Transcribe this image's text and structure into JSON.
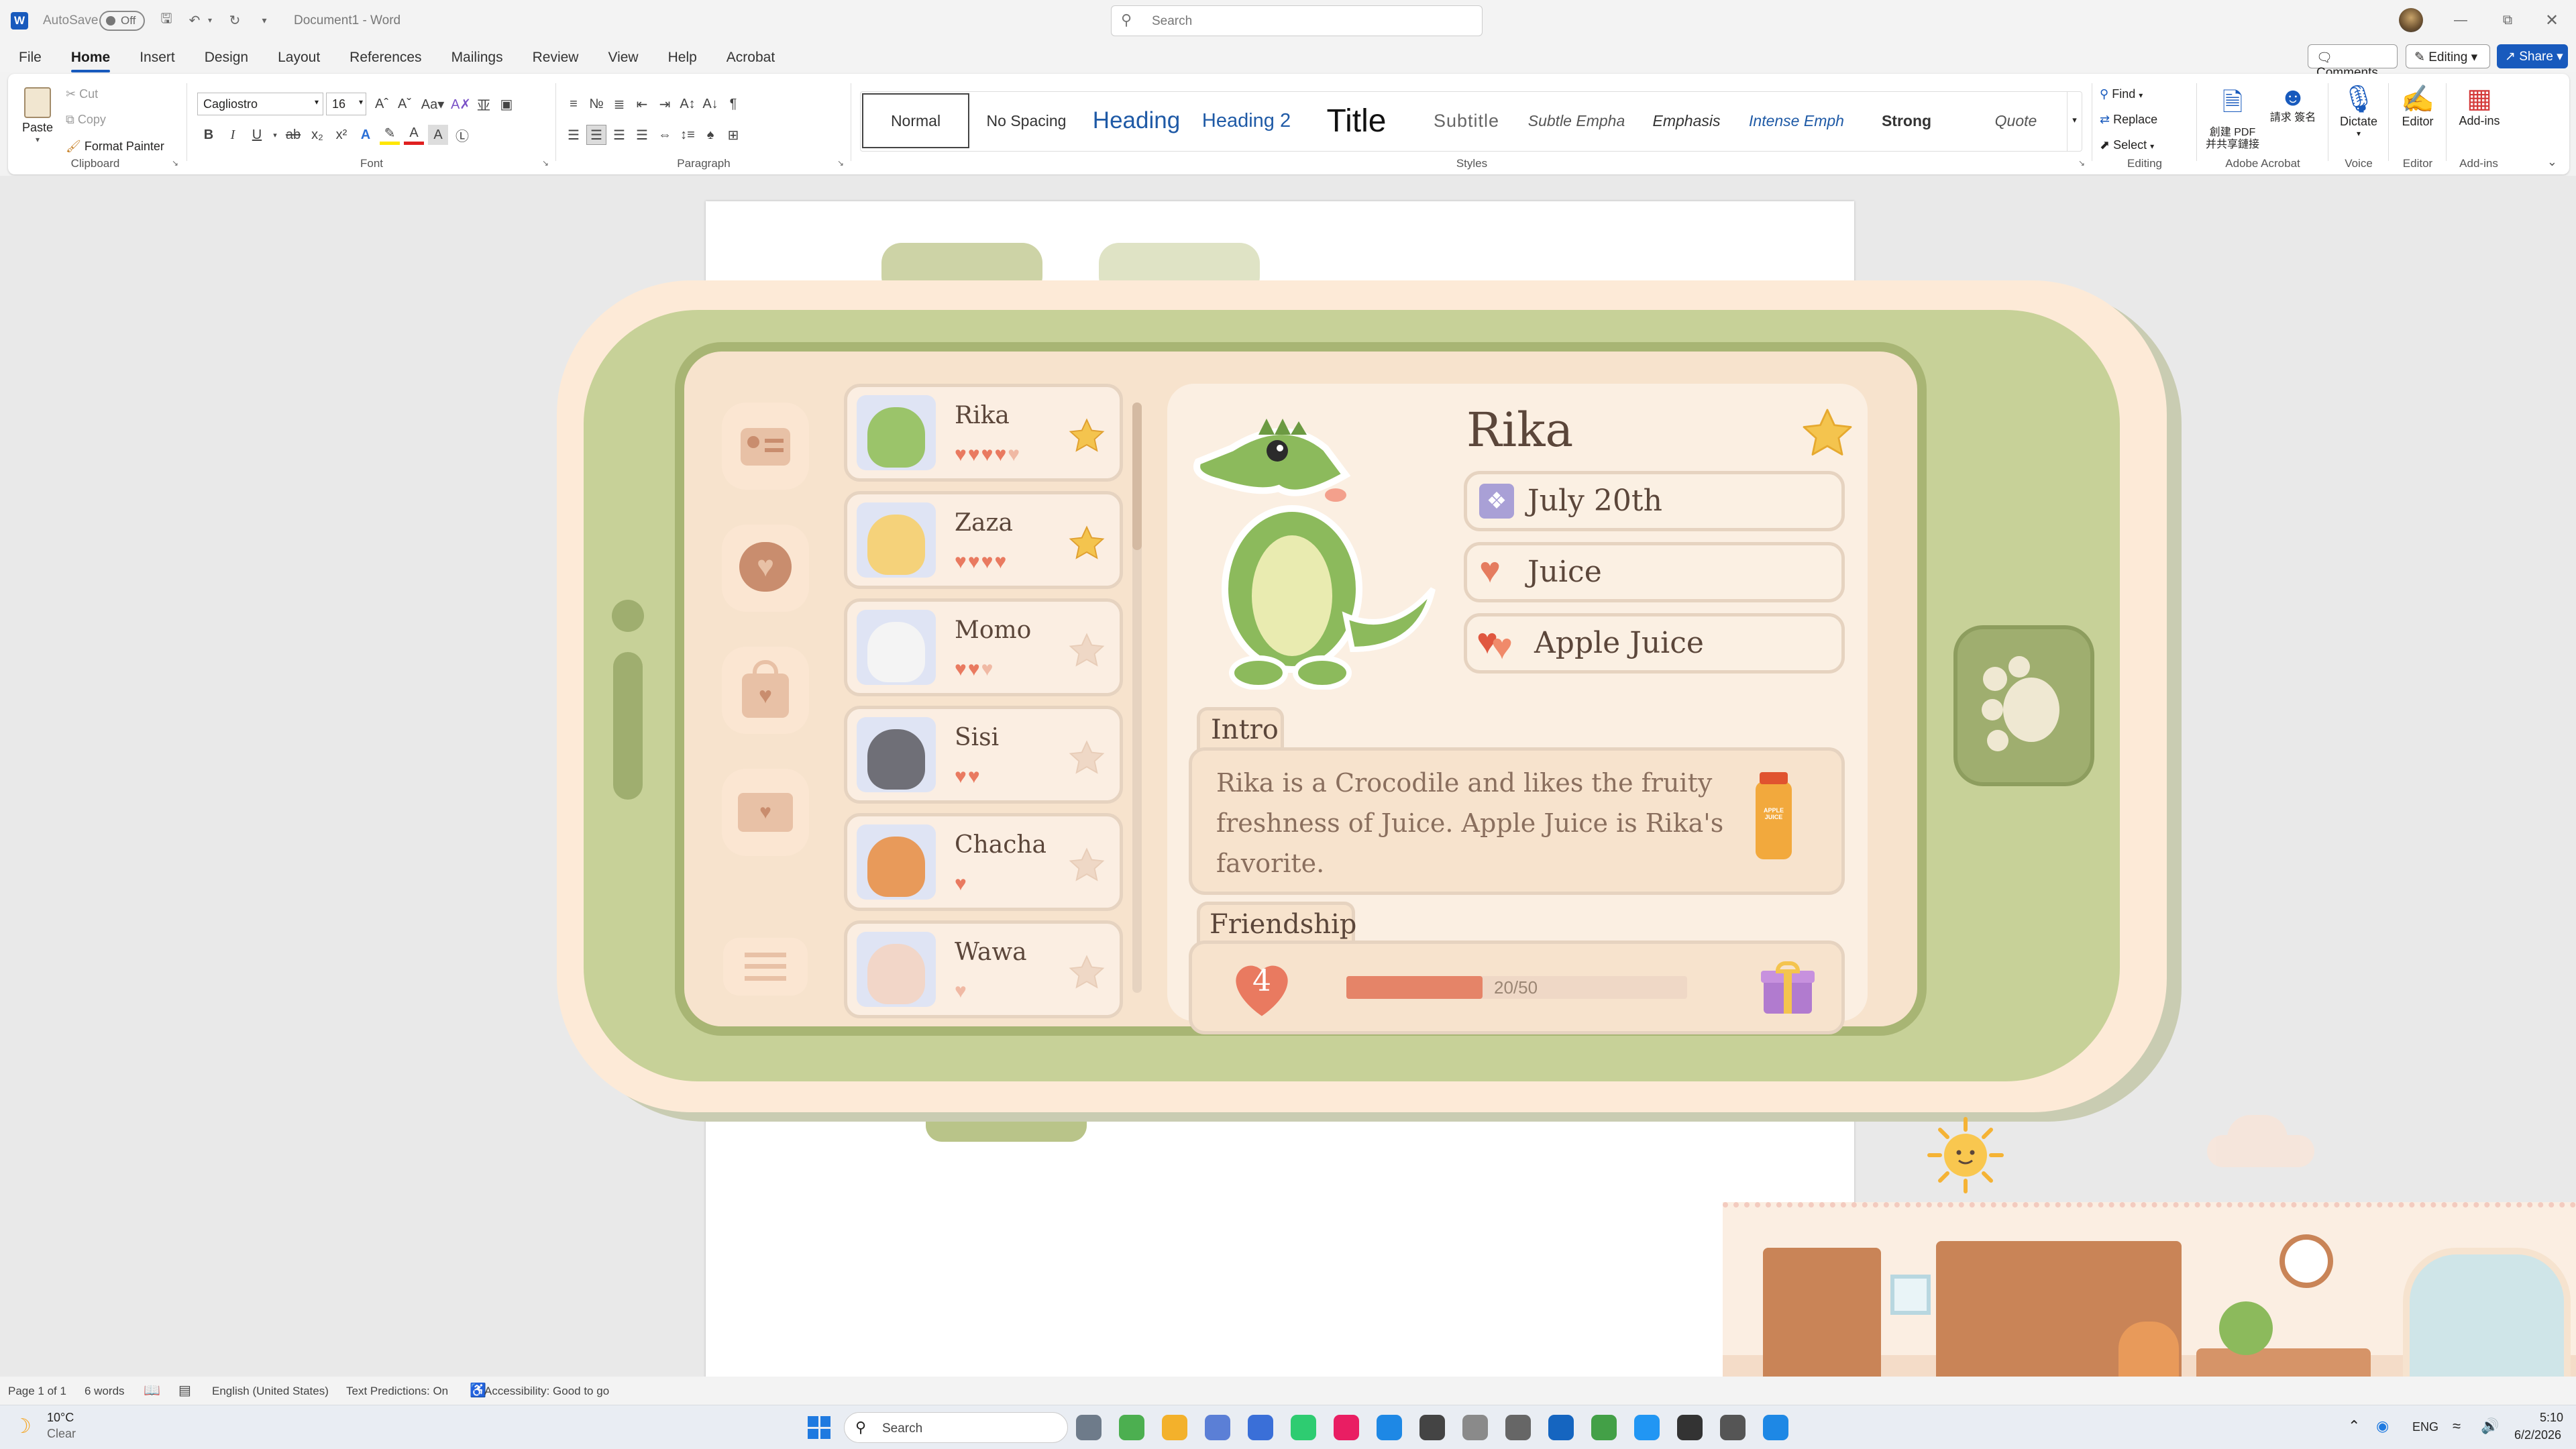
{
  "titlebar": {
    "autosave_label": "AutoSave",
    "autosave_state": "Off",
    "doc_title": "Document1  -  Word",
    "search_placeholder": "Search"
  },
  "menu": {
    "tabs": [
      "File",
      "Home",
      "Insert",
      "Design",
      "Layout",
      "References",
      "Mailings",
      "Review",
      "View",
      "Help",
      "Acrobat"
    ],
    "active": "Home",
    "comments": "Comments",
    "editing": "Editing",
    "share": "Share"
  },
  "ribbon": {
    "clipboard": {
      "paste": "Paste",
      "cut": "Cut",
      "copy": "Copy",
      "format_painter": "Format Painter",
      "label": "Clipboard"
    },
    "font": {
      "name": "Cagliostro",
      "size": "16",
      "label": "Font"
    },
    "paragraph": {
      "label": "Paragraph"
    },
    "styles": {
      "items": [
        "Normal",
        "No Spacing",
        "Heading",
        "Heading 2",
        "Title",
        "Subtitle",
        "Subtle Empha",
        "Emphasis",
        "Intense Emph",
        "Strong",
        "Quote"
      ],
      "label": "Styles"
    },
    "editing": {
      "find": "Find",
      "replace": "Replace",
      "select": "Select",
      "label": "Editing"
    },
    "acrobat": {
      "b1": "創建 PDF 并共享鏈接",
      "b2": "請求 簽名",
      "label": "Adobe Acrobat"
    },
    "voice": {
      "b": "Dictate",
      "label": "Voice"
    },
    "editor": {
      "b": "Editor",
      "label": "Editor"
    },
    "addins": {
      "b": "Add-ins",
      "label": "Add-ins"
    }
  },
  "game": {
    "characters": [
      {
        "name": "Rika",
        "hearts": 4.5,
        "favorite": true,
        "color": "#9bc46a"
      },
      {
        "name": "Zaza",
        "hearts": 4,
        "favorite": true,
        "color": "#f5d27a"
      },
      {
        "name": "Momo",
        "hearts": 2.5,
        "favorite": false,
        "color": "#f4f4f4"
      },
      {
        "name": "Sisi",
        "hearts": 2,
        "favorite": false,
        "color": "#6f6f77"
      },
      {
        "name": "Chacha",
        "hearts": 1,
        "favorite": false,
        "color": "#e89a5a"
      },
      {
        "name": "Wawa",
        "hearts": 0.5,
        "favorite": false,
        "color": "#f2d6c8"
      }
    ],
    "profile": {
      "name": "Rika",
      "birthday": "July 20th",
      "likes": "Juice",
      "favorite_item": "Apple Juice",
      "intro_label": "Intro",
      "intro_text": "Rika is a Crocodile and likes the fruity freshness of Juice. Apple Juice is Rika's favorite.",
      "juice_label": "APPLE JUICE",
      "friendship_label": "Friendship",
      "friendship_level": "4",
      "friendship_progress": "20/50",
      "friendship_fraction": 0.4
    }
  },
  "statusbar": {
    "page": "Page 1 of 1",
    "words": "6 words",
    "language": "English (United States)",
    "predictions": "Text Predictions: On",
    "accessibility": "Accessibility: Good to go"
  },
  "taskbar": {
    "weather_temp": "10°C",
    "weather_desc": "Clear",
    "search": "Search",
    "lang": "ENG",
    "time": "5:10",
    "date": "6/2/2026"
  }
}
